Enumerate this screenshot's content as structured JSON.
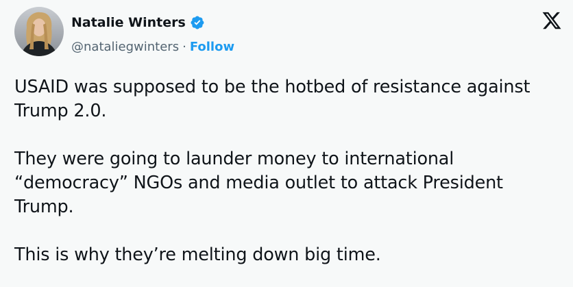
{
  "author": {
    "display_name": "Natalie Winters",
    "handle": "@nataliegwinters",
    "separator": "·",
    "follow_label": "Follow",
    "verified": true
  },
  "icons": {
    "avatar": "profile-photo",
    "verified": "verified-badge-icon",
    "brand": "x-logo-icon"
  },
  "colors": {
    "background": "#f7f9f9",
    "text": "#0f1419",
    "secondary_text": "#536471",
    "accent": "#1d9bf0"
  },
  "tweet": {
    "paragraphs": [
      "USAID was supposed to be the hotbed of resistance against Trump 2.0.",
      "They were going to launder money to international “democracy” NGOs and media outlet to attack President Trump.",
      "This is why they’re melting down big time."
    ]
  }
}
